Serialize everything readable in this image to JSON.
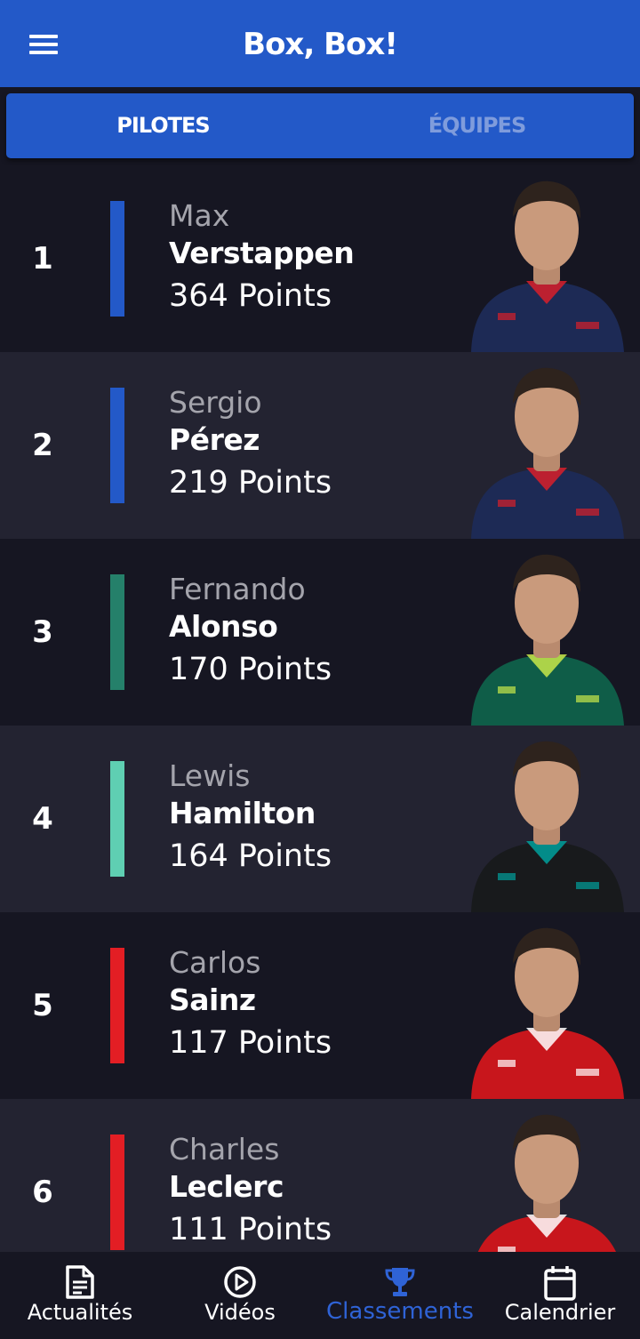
{
  "app": {
    "title": "Box, Box!"
  },
  "tabs": [
    {
      "label": "PILOTES",
      "active": true
    },
    {
      "label": "ÉQUIPES",
      "active": false
    }
  ],
  "drivers": [
    {
      "position": "1",
      "first_name": "Max",
      "last_name": "Verstappen",
      "points": "364 Points",
      "team_color": "#2359c8",
      "suit_color": "#1d2a55",
      "accent": "#d81f2a"
    },
    {
      "position": "2",
      "first_name": "Sergio",
      "last_name": "Pérez",
      "points": "219 Points",
      "team_color": "#2359c8",
      "suit_color": "#1d2a55",
      "accent": "#d81f2a"
    },
    {
      "position": "3",
      "first_name": "Fernando",
      "last_name": "Alonso",
      "points": "170 Points",
      "team_color": "#25806a",
      "suit_color": "#0f5d48",
      "accent": "#c8e84a"
    },
    {
      "position": "4",
      "first_name": "Lewis",
      "last_name": "Hamilton",
      "points": "164 Points",
      "team_color": "#5fcfb2",
      "suit_color": "#181a1c",
      "accent": "#00a19c"
    },
    {
      "position": "5",
      "first_name": "Carlos",
      "last_name": "Sainz",
      "points": "117 Points",
      "team_color": "#e31e24",
      "suit_color": "#c8161c",
      "accent": "#ffffff"
    },
    {
      "position": "6",
      "first_name": "Charles",
      "last_name": "Leclerc",
      "points": "111 Points",
      "team_color": "#e31e24",
      "suit_color": "#c8161c",
      "accent": "#ffffff"
    }
  ],
  "bottom_nav": [
    {
      "label": "Actualités",
      "icon": "news-icon",
      "active": false
    },
    {
      "label": "Vidéos",
      "icon": "play-circle-icon",
      "active": false
    },
    {
      "label": "Classements",
      "icon": "trophy-icon",
      "active": true
    },
    {
      "label": "Calendrier",
      "icon": "calendar-icon",
      "active": false
    }
  ],
  "colors": {
    "primary": "#2359c8",
    "background": "#161622",
    "row_alt": "#232331",
    "active_nav": "#2f63d6"
  }
}
